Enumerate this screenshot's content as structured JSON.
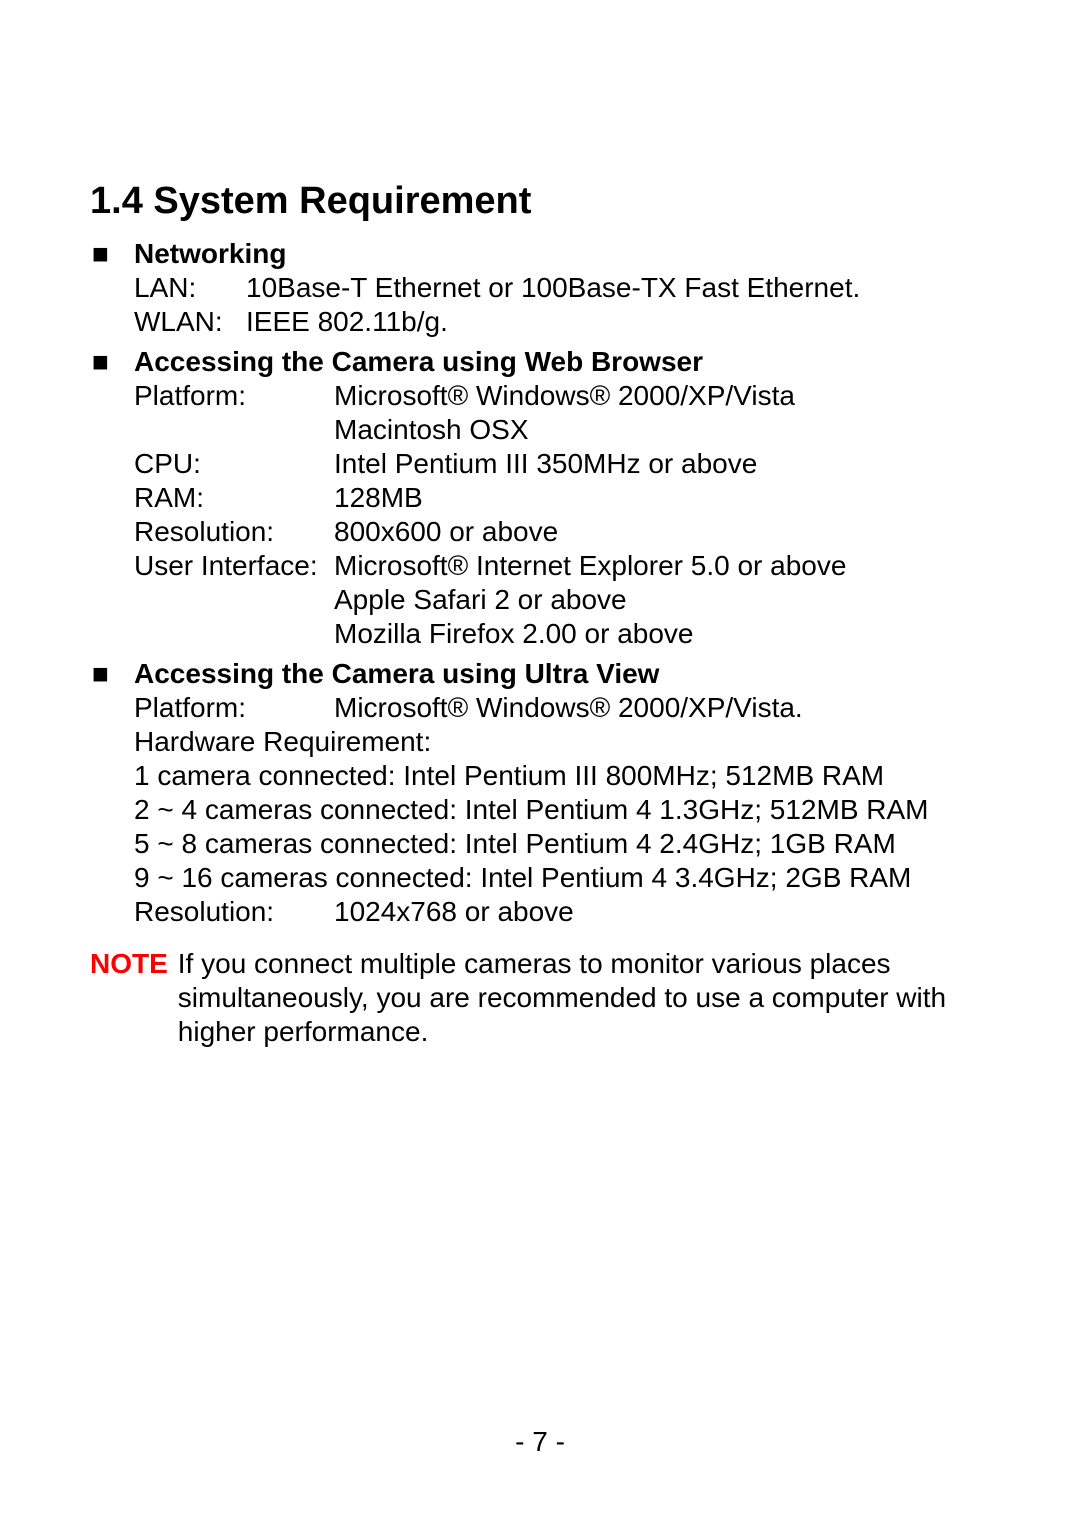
{
  "title": "1.4  System Requirement",
  "networking": {
    "heading": "Networking",
    "lan_key": "LAN:",
    "lan_val": "10Base-T Ethernet or 100Base-TX Fast Ethernet.",
    "wlan_key": "WLAN:",
    "wlan_val": "IEEE 802.11b/g."
  },
  "webbrowser": {
    "heading": "Accessing the Camera using Web Browser",
    "platform_key": "Platform:",
    "platform_val1": "Microsoft® Windows® 2000/XP/Vista",
    "platform_val2": "Macintosh OSX",
    "cpu_key": "CPU:",
    "cpu_val": "Intel Pentium III 350MHz or above",
    "ram_key": "RAM:",
    "ram_val": "128MB",
    "res_key": "Resolution:",
    "res_val": "800x600 or above",
    "ui_key": "User Interface:",
    "ui_val1": "Microsoft® Internet Explorer 5.0 or above",
    "ui_val2": "Apple Safari 2 or above",
    "ui_val3": "Mozilla Firefox  2.00 or above"
  },
  "ultraview": {
    "heading": "Accessing the Camera using Ultra View",
    "platform_key": "Platform:",
    "platform_val": "Microsoft® Windows® 2000/XP/Vista.",
    "hw_label": "Hardware Requirement:",
    "hw1": "1 camera connected: Intel Pentium III 800MHz; 512MB RAM",
    "hw2": "2 ~ 4 cameras connected: Intel Pentium 4 1.3GHz; 512MB RAM",
    "hw3": "5 ~ 8 cameras connected: Intel Pentium 4 2.4GHz; 1GB RAM",
    "hw4": "9 ~ 16 cameras connected: Intel Pentium 4 3.4GHz; 2GB RAM",
    "res_key": "Resolution:",
    "res_val": "1024x768 or above"
  },
  "note": {
    "label": "NOTE",
    "body": "If you connect multiple cameras to monitor various places simultaneously, you are recommended to use a computer with higher performance."
  },
  "page_number": "- 7 -",
  "bullet_glyph": "■"
}
